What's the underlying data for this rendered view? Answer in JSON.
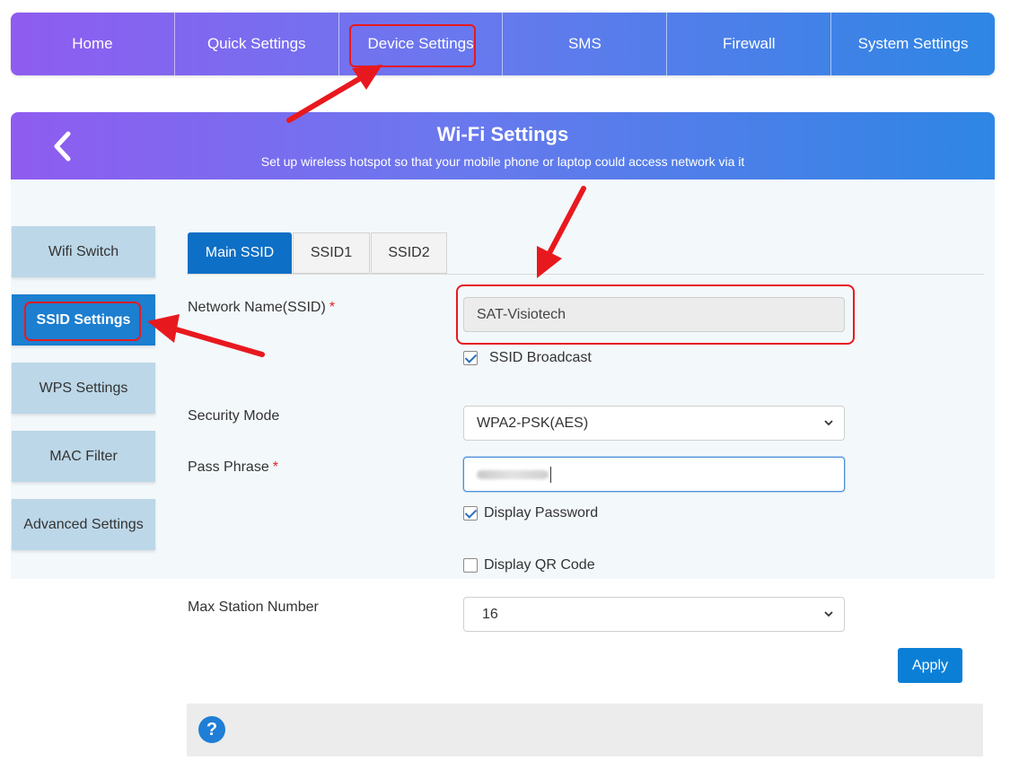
{
  "nav": {
    "items": [
      {
        "label": "Home"
      },
      {
        "label": "Quick Settings"
      },
      {
        "label": "Device Settings"
      },
      {
        "label": "SMS"
      },
      {
        "label": "Firewall"
      },
      {
        "label": "System Settings"
      }
    ]
  },
  "header": {
    "title": "Wi-Fi Settings",
    "subtitle": "Set up wireless hotspot so that your mobile phone or laptop could access network via it"
  },
  "sidebar": {
    "items": [
      {
        "label": "Wifi Switch"
      },
      {
        "label": "SSID Settings"
      },
      {
        "label": "WPS Settings"
      },
      {
        "label": "MAC Filter"
      },
      {
        "label": "Advanced Settings"
      }
    ]
  },
  "tabs": [
    {
      "label": "Main SSID"
    },
    {
      "label": "SSID1"
    },
    {
      "label": "SSID2"
    }
  ],
  "form": {
    "ssid_label": "Network Name(SSID)",
    "ssid_value": "SAT-Visiotech",
    "required_mark": "*",
    "ssid_broadcast_label": "SSID Broadcast",
    "security_mode_label": "Security Mode",
    "security_mode_value": "WPA2-PSK(AES)",
    "pass_phrase_label": "Pass Phrase",
    "display_password_label": "Display Password",
    "display_qr_label": "Display QR Code",
    "max_station_label": "Max Station Number",
    "max_station_value": "16",
    "apply_label": "Apply"
  },
  "help": {
    "icon_text": "?"
  },
  "colors": {
    "accent": "#0d6fc6",
    "highlight": "#e8191e",
    "gradient_start": "#8f5cf0",
    "gradient_end": "#2e86e4"
  },
  "icons": {
    "back": "chevron-left-icon",
    "select": "chevron-down-icon",
    "help": "question-circle-icon"
  }
}
